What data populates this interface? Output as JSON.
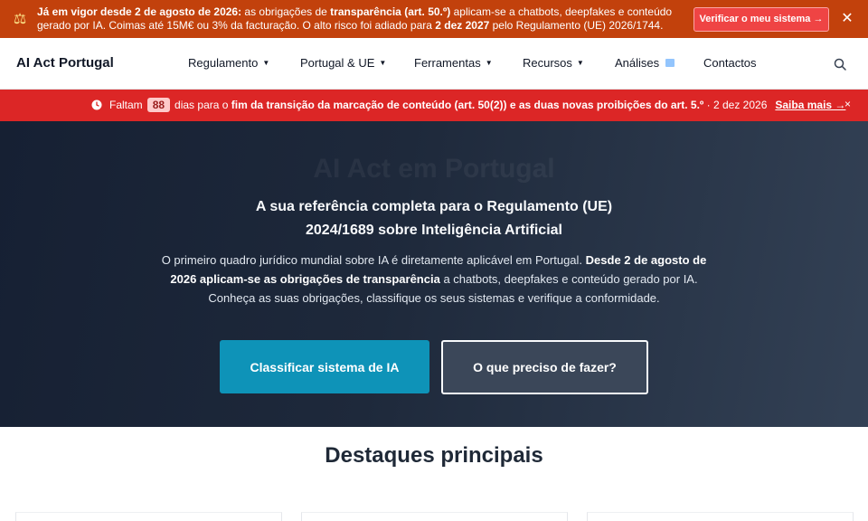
{
  "top_banner": {
    "part1": "Já em vigor desde 2 de agosto de 2026:",
    "part2": " as obrigações de ",
    "part3": "transparência (art. 50.º)",
    "part4": " aplicam-se a chatbots, deepfakes e conteúdo gerado por IA. Coimas até 15M€ ou 3% da facturação. O alto risco foi adiado para ",
    "part5": "2 dez 2027",
    "part6": " pelo Regulamento (UE) 2026/1744.",
    "button_label": "Verificar o meu sistema →",
    "close_label": "✕",
    "icon": "scale-icon"
  },
  "navbar": {
    "brand": "AI Act Portugal",
    "items": [
      {
        "label": "Regulamento",
        "dropdown": true
      },
      {
        "label": "Portugal & UE",
        "dropdown": true
      },
      {
        "label": "Ferramentas",
        "dropdown": true
      },
      {
        "label": "Recursos",
        "dropdown": true
      },
      {
        "label": "Análises",
        "dropdown": false
      },
      {
        "label": "Contactos",
        "dropdown": false
      }
    ],
    "caret": "▼",
    "search_icon": "search-icon"
  },
  "countdown": {
    "prefix": "Faltam",
    "days": "88",
    "middle": "dias para o ",
    "bold": "fim da transição da marcação de conteúdo (art. 50(2)) e as duas novas proibições do art. 5.º",
    "suffix": " · 2 dez 2026",
    "link": "Saiba mais →",
    "close_label": "×"
  },
  "hero": {
    "ghost_title": "AI Act em Portugal",
    "headline_line1": "A sua referência completa para o Regulamento (UE)",
    "headline_line2": "2024/1689 sobre Inteligência Artificial",
    "intro_part1": "O primeiro quadro jurídico mundial sobre IA é diretamente aplicável em Portugal. ",
    "intro_bold": "Desde 2 de agosto de 2026 aplicam-se as obrigações de transparência",
    "intro_part2": " a chatbots, deepfakes e conteúdo gerado por IA. Conheça as suas obrigações, classifique os seus sistemas e verifique a conformidade.",
    "primary_button": "Classificar sistema de IA",
    "secondary_button": "O que preciso de fazer?"
  },
  "highlights": {
    "title": "Destaques principais"
  },
  "colors": {
    "top_banner_bg": "#c2410c",
    "countdown_bg": "#dc2626",
    "primary_button": "#0e93b8",
    "hero_bg": "#1e293b"
  }
}
